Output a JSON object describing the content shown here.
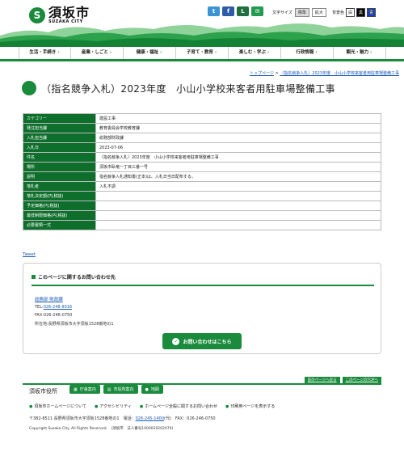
{
  "header": {
    "logo_mark": "S",
    "logo_jp": "須坂市",
    "logo_en": "SUZAKA CITY",
    "social": [
      "t",
      "f",
      "L",
      "✉"
    ],
    "text_size_label": "文字サイズ",
    "text_size_standard": "標準",
    "text_size_large": "拡大",
    "bg_color_label": "背景色",
    "bg_white": "白",
    "bg_black": "黒",
    "bg_blue": "青"
  },
  "nav": [
    "生活・手続き",
    "産業・しごと",
    "健康・福祉",
    "子育て・教育",
    "楽しむ・学ぶ",
    "行政情報",
    "観光・魅力"
  ],
  "breadcrumb": {
    "top": "トップページ",
    "sep": " > ",
    "current": "（指名競争入札）2023年度　小山小学校来客者用駐車場整備工事"
  },
  "page_title": "（指名競争入札）2023年度　小山小学校来客者用駐車場整備工事",
  "table": [
    {
      "label": "カテゴリー",
      "value": "建設工事"
    },
    {
      "label": "発注担当課",
      "value": "教育委員会学校教育課"
    },
    {
      "label": "入札担当課",
      "value": "総務部財政課"
    },
    {
      "label": "入札日",
      "value": "2023-07-06"
    },
    {
      "label": "件名",
      "value": "（指名競争入札）2023年度　小山小学校来客者用駐車場整備工事"
    },
    {
      "label": "場所",
      "value": "須坂市臥竜一丁目三番一号"
    },
    {
      "label": "説明",
      "value": "指名競争入札通知書(正本)は、入札日当日配布する。"
    },
    {
      "label": "落札者",
      "value": "入札不調"
    },
    {
      "label": "落札決定額(円,税抜)",
      "value": ""
    },
    {
      "label": "予定価格(円,税抜)",
      "value": ""
    },
    {
      "label": "最低制限価格(円,税抜)",
      "value": ""
    },
    {
      "label": "必要書類一式",
      "value": ""
    }
  ],
  "tweet": "Tweet",
  "contact": {
    "heading": "このページに関するお問い合わせ先",
    "dept": "総務部 財政課",
    "tel_label": "TEL:",
    "tel": "026-248-9016",
    "fax": "FAX:026-246-0750",
    "address": "所在地:長野県須坂市大字須坂1528番地の1",
    "button": "お問い合わせはこちら"
  },
  "footer": {
    "back": "前のページへ戻る",
    "top": "このページのTOPへ",
    "name": "須坂市役所",
    "buttons": [
      "庁舎案内",
      "市役所案内",
      "地図"
    ],
    "links": [
      "須坂市ホームページについて",
      "アクセシビリティ",
      "ホームページ全般に関するお問い合わせ",
      "印刷用ページを表示する"
    ],
    "address_line_1": "〒382-8511 長野県須坂市大字須坂1528番地の1　電話：",
    "address_tel": "026-245-1400",
    "address_line_2": "(代)　FAX：026-246-0750",
    "copyright": "Copyright Suzaka City. All Rights Reserved.　(須坂市　法人番号1000020202070)"
  },
  "colors": {
    "brand_green": "#1a8a3c",
    "table_header": "#0e6e2c",
    "link": "#1a5ab8"
  }
}
